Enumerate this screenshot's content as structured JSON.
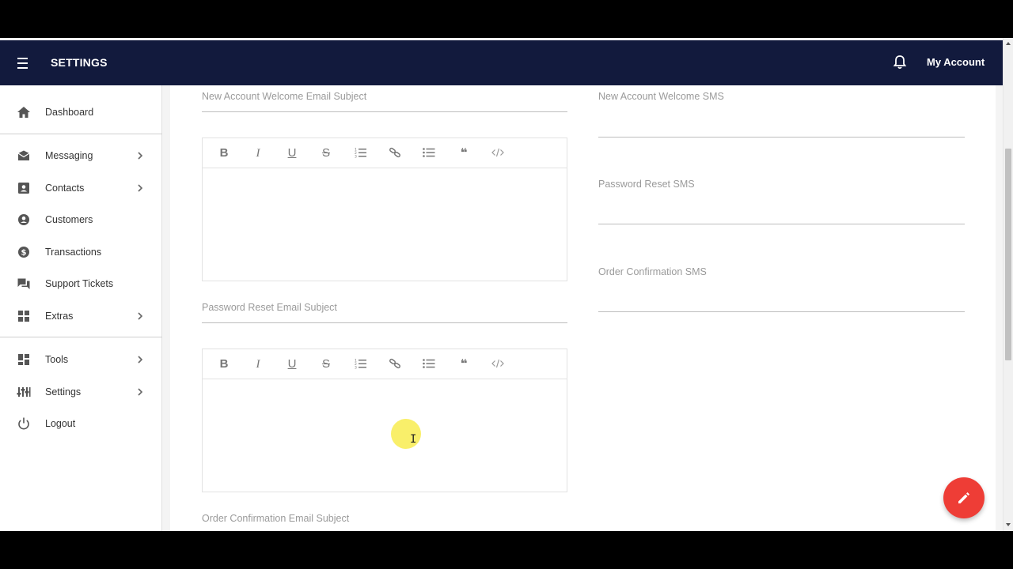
{
  "app": {
    "title": "SETTINGS",
    "account_label": "My Account"
  },
  "sidebar": {
    "items": [
      {
        "label": "Dashboard",
        "icon": "home-icon"
      },
      {
        "label": "Messaging",
        "icon": "envelope-icon"
      },
      {
        "label": "Contacts",
        "icon": "contact-card-icon"
      },
      {
        "label": "Customers",
        "icon": "person-circle-icon"
      },
      {
        "label": "Transactions",
        "icon": "dollar-circle-icon"
      },
      {
        "label": "Support Tickets",
        "icon": "chat-icon"
      },
      {
        "label": "Extras",
        "icon": "grid-icon"
      },
      {
        "label": "Tools",
        "icon": "dashboard-tiles-icon"
      },
      {
        "label": "Settings",
        "icon": "sliders-icon"
      },
      {
        "label": "Logout",
        "icon": "power-icon"
      }
    ]
  },
  "form": {
    "left": {
      "welcome_email_subject": "New Account Welcome Email Subject",
      "password_reset_email_subject": "Password Reset Email Subject",
      "order_confirmation_email_subject": "Order Confirmation Email Subject"
    },
    "right": {
      "welcome_sms": "New Account Welcome SMS",
      "password_reset_sms": "Password Reset SMS",
      "order_confirmation_sms": "Order Confirmation SMS"
    },
    "toolbar": {
      "bold": "B",
      "italic": "I",
      "underline": "U",
      "strike": "S",
      "quote": "❝"
    }
  },
  "colors": {
    "appbar": "#121a3d",
    "fab": "#ee3d36"
  }
}
